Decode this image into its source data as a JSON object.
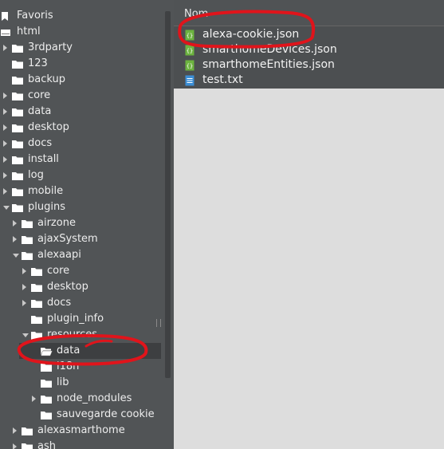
{
  "tree": {
    "items": [
      {
        "label": "Favoris",
        "icon": "bookmark-icon",
        "depth": 0,
        "arrow": "none",
        "selected": false
      },
      {
        "label": "html",
        "icon": "drive-icon",
        "depth": 0,
        "arrow": "none",
        "selected": false
      },
      {
        "label": "3rdparty",
        "icon": "folder-icon",
        "depth": 1,
        "arrow": "right",
        "selected": false
      },
      {
        "label": "123",
        "icon": "folder-icon",
        "depth": 1,
        "arrow": "none",
        "selected": false
      },
      {
        "label": "backup",
        "icon": "folder-icon",
        "depth": 1,
        "arrow": "none",
        "selected": false
      },
      {
        "label": "core",
        "icon": "folder-icon",
        "depth": 1,
        "arrow": "right",
        "selected": false
      },
      {
        "label": "data",
        "icon": "folder-icon",
        "depth": 1,
        "arrow": "right",
        "selected": false
      },
      {
        "label": "desktop",
        "icon": "folder-icon",
        "depth": 1,
        "arrow": "right",
        "selected": false
      },
      {
        "label": "docs",
        "icon": "folder-icon",
        "depth": 1,
        "arrow": "right",
        "selected": false
      },
      {
        "label": "install",
        "icon": "folder-icon",
        "depth": 1,
        "arrow": "right",
        "selected": false
      },
      {
        "label": "log",
        "icon": "folder-icon",
        "depth": 1,
        "arrow": "right",
        "selected": false
      },
      {
        "label": "mobile",
        "icon": "folder-icon",
        "depth": 1,
        "arrow": "right",
        "selected": false
      },
      {
        "label": "plugins",
        "icon": "folder-icon",
        "depth": 1,
        "arrow": "down",
        "selected": false
      },
      {
        "label": "airzone",
        "icon": "folder-icon",
        "depth": 2,
        "arrow": "right",
        "selected": false
      },
      {
        "label": "ajaxSystem",
        "icon": "folder-icon",
        "depth": 2,
        "arrow": "right",
        "selected": false
      },
      {
        "label": "alexaapi",
        "icon": "folder-icon",
        "depth": 2,
        "arrow": "down",
        "selected": false
      },
      {
        "label": "core",
        "icon": "folder-icon",
        "depth": 3,
        "arrow": "right",
        "selected": false
      },
      {
        "label": "desktop",
        "icon": "folder-icon",
        "depth": 3,
        "arrow": "right",
        "selected": false
      },
      {
        "label": "docs",
        "icon": "folder-icon",
        "depth": 3,
        "arrow": "right",
        "selected": false
      },
      {
        "label": "plugin_info",
        "icon": "folder-icon",
        "depth": 3,
        "arrow": "none",
        "selected": false
      },
      {
        "label": "resources",
        "icon": "folder-icon",
        "depth": 3,
        "arrow": "down",
        "selected": false
      },
      {
        "label": "data",
        "icon": "folder-open-icon",
        "depth": 4,
        "arrow": "none",
        "selected": true
      },
      {
        "label": "i18n",
        "icon": "folder-icon",
        "depth": 4,
        "arrow": "none",
        "selected": false
      },
      {
        "label": "lib",
        "icon": "folder-icon",
        "depth": 4,
        "arrow": "none",
        "selected": false
      },
      {
        "label": "node_modules",
        "icon": "folder-icon",
        "depth": 4,
        "arrow": "right",
        "selected": false
      },
      {
        "label": "sauvegarde cookie",
        "icon": "folder-icon",
        "depth": 4,
        "arrow": "none",
        "selected": false
      },
      {
        "label": "alexasmarthome",
        "icon": "folder-icon",
        "depth": 2,
        "arrow": "right",
        "selected": false
      },
      {
        "label": "ash",
        "icon": "folder-icon",
        "depth": 2,
        "arrow": "right",
        "selected": false
      }
    ]
  },
  "files": {
    "column_name": "Nom",
    "items": [
      {
        "name": "alexa-cookie.json",
        "icon": "json-file-icon"
      },
      {
        "name": "smarthomeDevices.json",
        "icon": "json-file-icon"
      },
      {
        "name": "smarthomeEntities.json",
        "icon": "json-file-icon"
      },
      {
        "name": "test.txt",
        "icon": "text-file-icon"
      }
    ]
  },
  "colors": {
    "tree_bg": "#515456",
    "list_bg": "#4c4f51",
    "empty_bg": "#dddddd",
    "json_icon": "#6cb33f",
    "txt_icon": "#3b8ed6",
    "annotation": "#e0141b"
  }
}
